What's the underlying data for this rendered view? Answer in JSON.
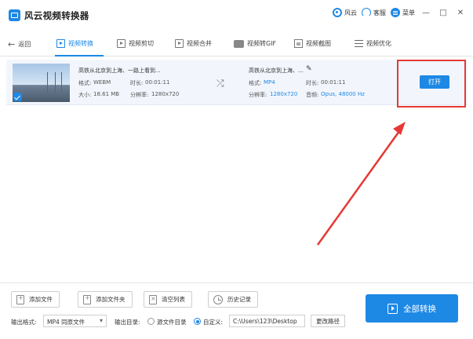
{
  "app": {
    "title": "风云视频转换器"
  },
  "titlebar": {
    "items": [
      {
        "label": "风云",
        "icon": "fengyun-icon"
      },
      {
        "label": "客服",
        "icon": "headset-icon"
      },
      {
        "label": "菜单",
        "icon": "menu-icon"
      }
    ],
    "window_buttons": {
      "minimize": "—",
      "maximize": "□",
      "close": "✕"
    }
  },
  "nav": {
    "back_label": "返回",
    "tabs": [
      {
        "label": "视频转换",
        "active": true,
        "icon": "play-icon"
      },
      {
        "label": "视频剪切",
        "active": false,
        "icon": "play-icon"
      },
      {
        "label": "视频合并",
        "active": false,
        "icon": "play-icon"
      },
      {
        "label": "视频转GIF",
        "active": false,
        "icon": "gif-icon"
      },
      {
        "label": "视频截图",
        "active": false,
        "icon": "screenshot-icon"
      },
      {
        "label": "视频优化",
        "active": false,
        "icon": "sliders-icon"
      }
    ],
    "accent_color": "#1e88e5"
  },
  "file": {
    "source": {
      "name": "高铁从北京到上海、一路上看到...",
      "format_label": "格式:",
      "format": "WEBM",
      "duration_label": "时长:",
      "duration": "00:01:11",
      "size_label": "大小:",
      "size": "18.61 MB",
      "resolution_label": "分辨率:",
      "resolution": "1280x720"
    },
    "output": {
      "name": "高铁从北京到上海、...",
      "format_label": "格式:",
      "format": "MP4",
      "duration_label": "时长:",
      "duration": "00:01:11",
      "resolution_label": "分辨率:",
      "resolution": "1280x720",
      "audio_label": "音频:",
      "audio": "Opus, 48000 Hz"
    },
    "open_button": "打开"
  },
  "toolbar": {
    "add_file": "添加文件",
    "add_folder": "添加文件夹",
    "clear_list": "清空列表",
    "history": "历史记录",
    "convert_all": "全部转换"
  },
  "output_settings": {
    "format_label": "输出格式:",
    "format_value": "MP4 同原文件",
    "dir_label": "输出目录:",
    "source_dir_label": "源文件目录",
    "custom_label": "自定义:",
    "custom_path": "C:\\Users\\123\\Desktop",
    "change_path": "更改路径",
    "selected": "custom"
  },
  "annotation_color": "#e53935"
}
